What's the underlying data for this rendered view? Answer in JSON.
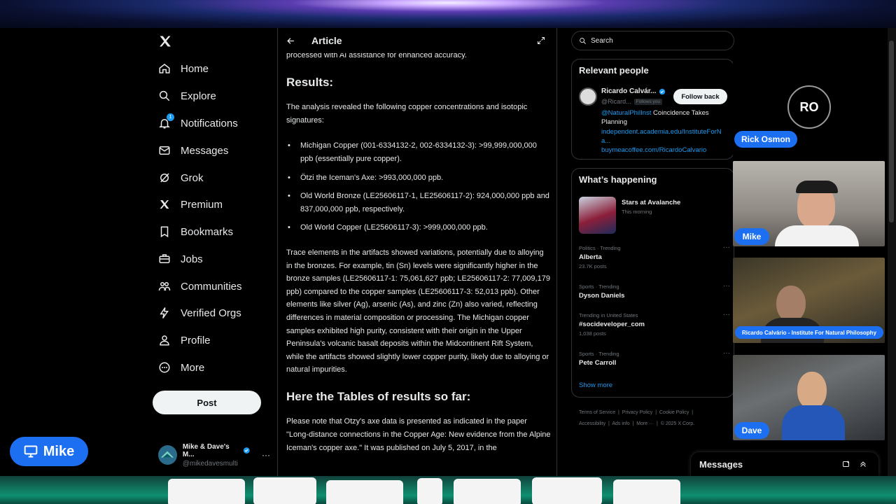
{
  "nav": {
    "logo": "x-logo",
    "items": [
      {
        "label": "Home",
        "icon": "home-icon"
      },
      {
        "label": "Explore",
        "icon": "search-icon"
      },
      {
        "label": "Notifications",
        "icon": "bell-icon",
        "badge": "1"
      },
      {
        "label": "Messages",
        "icon": "envelope-icon"
      },
      {
        "label": "Grok",
        "icon": "grok-icon"
      },
      {
        "label": "Premium",
        "icon": "x-icon"
      },
      {
        "label": "Bookmarks",
        "icon": "bookmark-icon"
      },
      {
        "label": "Jobs",
        "icon": "briefcase-icon"
      },
      {
        "label": "Communities",
        "icon": "people-icon"
      },
      {
        "label": "Verified Orgs",
        "icon": "lightning-icon"
      },
      {
        "label": "Profile",
        "icon": "person-icon"
      },
      {
        "label": "More",
        "icon": "more-circle-icon"
      }
    ],
    "post_label": "Post",
    "account": {
      "name": "Mike & Dave's M...",
      "handle": "@mikedavesmulti"
    }
  },
  "overlay": {
    "mike_big_tag": "Mike",
    "ro_initials": "RO",
    "rick_tag": "Rick Osmon",
    "mike_tag": "Mike",
    "ricardo_tag": "Ricardo Calvário - Institute For Natural Philosophy",
    "dave_tag": "Dave"
  },
  "article": {
    "header_title": "Article",
    "top_line": "processed with AI assistance for enhanced accuracy.",
    "results_heading": "Results:",
    "intro": "The analysis revealed the following copper concentrations and isotopic signatures:",
    "bullets": [
      "Michigan Copper (001-6334132-2, 002-6334132-3): >99,999,000,000 ppb (essentially pure copper).",
      "Ötzi the Iceman's Axe: >993,000,000 ppb.",
      "Old World Bronze (LE25606117-1, LE25606117-2): 924,000,000 ppb and 837,000,000 ppb, respectively.",
      "Old World Copper (LE25606117-3): >999,000,000 ppb."
    ],
    "trace_paragraph": "Trace elements in the artifacts showed variations, potentially due to alloying in the bronzes. For example, tin (Sn) levels were significantly higher in the bronze samples (LE25606117-1: 75,061,627 ppb; LE25606117-2: 77,009,179 ppb) compared to the copper samples (LE25606117-3: 52,013 ppb). Other elements like silver (Ag), arsenic (As), and zinc (Zn) also varied, reflecting differences in material composition or processing. The Michigan copper samples exhibited high purity, consistent with their origin in the Upper Peninsula's volcanic basalt deposits within the Midcontinent Rift System, while the artifacts showed slightly lower copper purity, likely due to alloying or natural impurities.",
    "tables_heading": "Here the Tables of results so far:",
    "tables_paragraph": "Please note that Otzy's axe data is presented as indicated in the paper \"Long-distance connections in the Copper Age: New evidence from the Alpine Iceman's copper axe.\" It was published on July 5, 2017, in the"
  },
  "sidebar": {
    "search_placeholder": "Search",
    "relevant_title": "Relevant people",
    "person": {
      "name": "Ricardo Calvár...",
      "handle": "@Ricard...",
      "follows_you": "Follows you",
      "follow_label": "Follow back",
      "bio_mention": "@NaturalPhilInst",
      "bio_text": " Coincidence Takes Planning",
      "link1": "independent.academia.edu/InstituteForNa...",
      "link2": "buymeacoffee.com/RicardoCalvario"
    },
    "happening_title": "What’s happening",
    "event": {
      "name": "Stars at Avalanche",
      "time": "This morning"
    },
    "trends": [
      {
        "meta": "Politics · Trending",
        "name": "Alberta",
        "count": "23.7K posts"
      },
      {
        "meta": "Sports · Trending",
        "name": "Dyson Daniels",
        "count": ""
      },
      {
        "meta": "Trending in United States",
        "name": "#socideveloper_com",
        "count": "1,038 posts"
      },
      {
        "meta": "Sports · Trending",
        "name": "Pete Carroll",
        "count": ""
      }
    ],
    "show_more": "Show more",
    "footer": [
      "Terms of Service",
      "Privacy Policy",
      "Cookie Policy",
      "Accessibility",
      "Ads info",
      "More ···",
      "© 2025 X Corp."
    ],
    "messages_label": "Messages"
  },
  "colors": {
    "accent": "#1d9bf0",
    "tag_blue": "#1d6ff2",
    "border": "#2f3336"
  }
}
